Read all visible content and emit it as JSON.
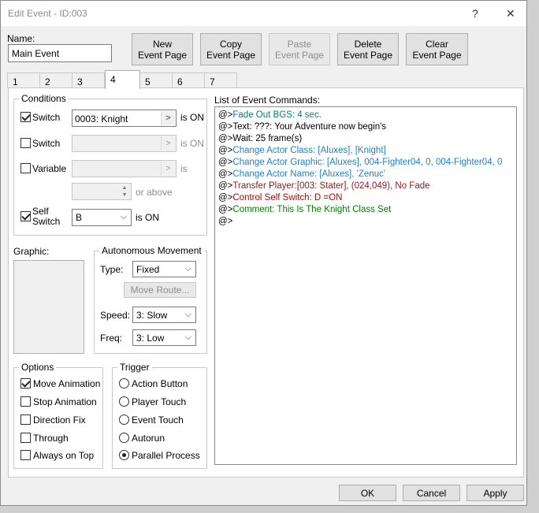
{
  "window": {
    "title": "Edit Event - ID:003",
    "help_label": "?",
    "close_label": "✕"
  },
  "name": {
    "label": "Name:",
    "value": "Main Event"
  },
  "toolbar": {
    "new_page": "New\nEvent Page",
    "copy_page": "Copy\nEvent Page",
    "paste_page": "Paste\nEvent Page",
    "delete_page": "Delete\nEvent Page",
    "clear_page": "Clear\nEvent Page"
  },
  "tabs": [
    "1",
    "2",
    "3",
    "4",
    "5",
    "6",
    "7"
  ],
  "conditions": {
    "title": "Conditions",
    "switch1": {
      "label": "Switch",
      "value": "0003: Knight",
      "suffix": "is ON"
    },
    "switch2": {
      "label": "Switch",
      "value": "",
      "suffix": "is ON"
    },
    "variable": {
      "label": "Variable",
      "value": "",
      "suffix": "is"
    },
    "variable_value": {
      "value": "",
      "suffix": "or above"
    },
    "self_switch": {
      "label": "Self\nSwitch",
      "value": "B",
      "suffix": "is ON"
    }
  },
  "graphic": {
    "label": "Graphic:"
  },
  "autonomous": {
    "title": "Autonomous Movement",
    "type_label": "Type:",
    "type_value": "Fixed",
    "move_route": "Move Route...",
    "speed_label": "Speed:",
    "speed_value": "3: Slow",
    "freq_label": "Freq:",
    "freq_value": "3: Low"
  },
  "options": {
    "title": "Options",
    "move_animation": "Move Animation",
    "stop_animation": "Stop Animation",
    "direction_fix": "Direction Fix",
    "through": "Through",
    "always_on_top": "Always on Top"
  },
  "trigger": {
    "title": "Trigger",
    "action_button": "Action Button",
    "player_touch": "Player Touch",
    "event_touch": "Event Touch",
    "autorun": "Autorun",
    "parallel_process": "Parallel Process"
  },
  "commands": {
    "label": "List of Event Commands:",
    "items": [
      {
        "prefix": "@>",
        "text": "Fade Out BGS: 4 sec."
      },
      {
        "prefix": "@>",
        "text": "Text: ???: Your Adventure now begin's"
      },
      {
        "prefix": "@>",
        "text": "Wait: 25 frame(s)"
      },
      {
        "prefix": "@>",
        "text": "Change Actor Class: [Aluxes], [Knight]"
      },
      {
        "prefix": "@>",
        "text": "Change Actor Graphic: [Aluxes], 004-Fighter04, 0, 004-Fighter04, 0"
      },
      {
        "prefix": "@>",
        "text": "Change Actor Name: [Aluxes], 'Zenuc'"
      },
      {
        "prefix": "@>",
        "text": "Transfer Player:[003: Stater], (024,049), No Fade"
      },
      {
        "prefix": "@>",
        "text": "Control Self Switch: D =ON"
      },
      {
        "prefix": "@>",
        "text": "Comment: This Is The Knight Class Set"
      },
      {
        "prefix": "@>",
        "text": ""
      }
    ]
  },
  "footer": {
    "ok": "OK",
    "cancel": "Cancel",
    "apply": "Apply"
  }
}
